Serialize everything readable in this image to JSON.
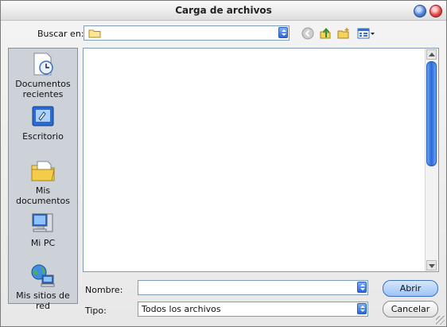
{
  "window": {
    "title": "Carga de archivos"
  },
  "toolbar": {
    "look_in_label": "Buscar en:",
    "look_in_value": "",
    "icons": [
      "back-icon",
      "up-folder-icon",
      "new-folder-icon",
      "views-menu-icon"
    ]
  },
  "places": [
    {
      "label_line1": "Documentos",
      "label_line2": "recientes",
      "icon": "recent-documents-icon"
    },
    {
      "label_line1": "Escritorio",
      "label_line2": "",
      "icon": "desktop-icon"
    },
    {
      "label_line1": "Mis documentos",
      "label_line2": "",
      "icon": "my-documents-icon"
    },
    {
      "label_line1": "Mi PC",
      "label_line2": "",
      "icon": "my-computer-icon"
    },
    {
      "label_line1": "Mis sitios de red",
      "label_line2": "",
      "icon": "network-places-icon"
    }
  ],
  "form": {
    "name_label": "Nombre:",
    "name_value": "",
    "type_label": "Tipo:",
    "type_value": "Todos los archivos"
  },
  "buttons": {
    "open": "Abrir",
    "cancel": "Cancelar"
  },
  "colors": {
    "accent": "#2c67d6",
    "sidebar": "#cdd2d9",
    "title_close": "#e34a4a",
    "title_min": "#4d82d8"
  }
}
